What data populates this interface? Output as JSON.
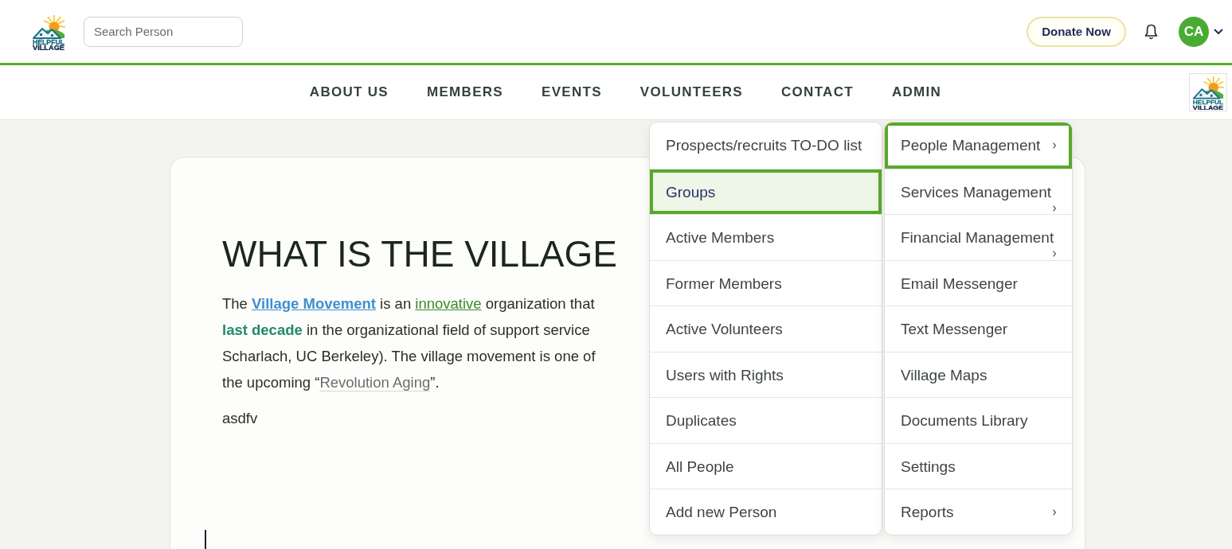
{
  "header": {
    "logo": {
      "line1": "HELPFUL",
      "line2": "VILLAGE"
    },
    "search": {
      "placeholder": "Search Person"
    },
    "donate_button": "Donate Now",
    "avatar": {
      "initials": "CA"
    }
  },
  "nav": {
    "items": [
      "ABOUT US",
      "MEMBERS",
      "EVENTS",
      "VOLUNTEERS",
      "CONTACT",
      "ADMIN"
    ],
    "logo": {
      "line1": "HELPFUL",
      "line2": "VILLAGE"
    }
  },
  "article": {
    "heading": "WHAT IS THE VILLAGE",
    "paragraph_lines": [
      [
        {
          "kind": "plain",
          "text": "The "
        },
        {
          "kind": "link",
          "text": "Village Movement"
        },
        {
          "kind": "plain",
          "text": " is an "
        },
        {
          "kind": "green_link",
          "text": "innovative"
        },
        {
          "kind": "plain",
          "text": " organization that"
        }
      ],
      [
        {
          "kind": "strong",
          "text": "last decade"
        },
        {
          "kind": "plain",
          "text": " in the organizational field of support service"
        }
      ],
      [
        {
          "kind": "plain",
          "text": "Scharlach, UC Berkeley). The village movement is one of"
        }
      ],
      [
        {
          "kind": "plain",
          "text": "the upcoming “"
        },
        {
          "kind": "quiet_link",
          "text": "Revolution Aging"
        },
        {
          "kind": "plain",
          "text": "”."
        }
      ]
    ],
    "note": "asdfv"
  },
  "admin_menu": {
    "items": [
      {
        "label": "People Management",
        "has_submenu": true,
        "expanded": true,
        "children": [
          {
            "label": "Prospects/recruits TO-DO list",
            "selected": false
          },
          {
            "label": "Groups",
            "selected": true
          },
          {
            "label": "Active Members",
            "selected": false
          },
          {
            "label": "Former Members",
            "selected": false
          },
          {
            "label": "Active Volunteers",
            "selected": false
          },
          {
            "label": "Users with Rights",
            "selected": false
          },
          {
            "label": "Duplicates",
            "selected": false
          },
          {
            "label": "All People",
            "selected": false
          },
          {
            "label": "Add new Person",
            "selected": false
          }
        ]
      },
      {
        "label": "Services Management",
        "has_submenu": true,
        "expanded": false
      },
      {
        "label": "Financial Management",
        "has_submenu": true,
        "expanded": false
      },
      {
        "label": "Email Messenger",
        "has_submenu": false,
        "expanded": false
      },
      {
        "label": "Text Messenger",
        "has_submenu": false,
        "expanded": false
      },
      {
        "label": "Village Maps",
        "has_submenu": false,
        "expanded": false
      },
      {
        "label": "Documents Library",
        "has_submenu": false,
        "expanded": false
      },
      {
        "label": "Settings",
        "has_submenu": false,
        "expanded": false
      },
      {
        "label": "Reports",
        "has_submenu": true,
        "expanded": false
      }
    ]
  }
}
